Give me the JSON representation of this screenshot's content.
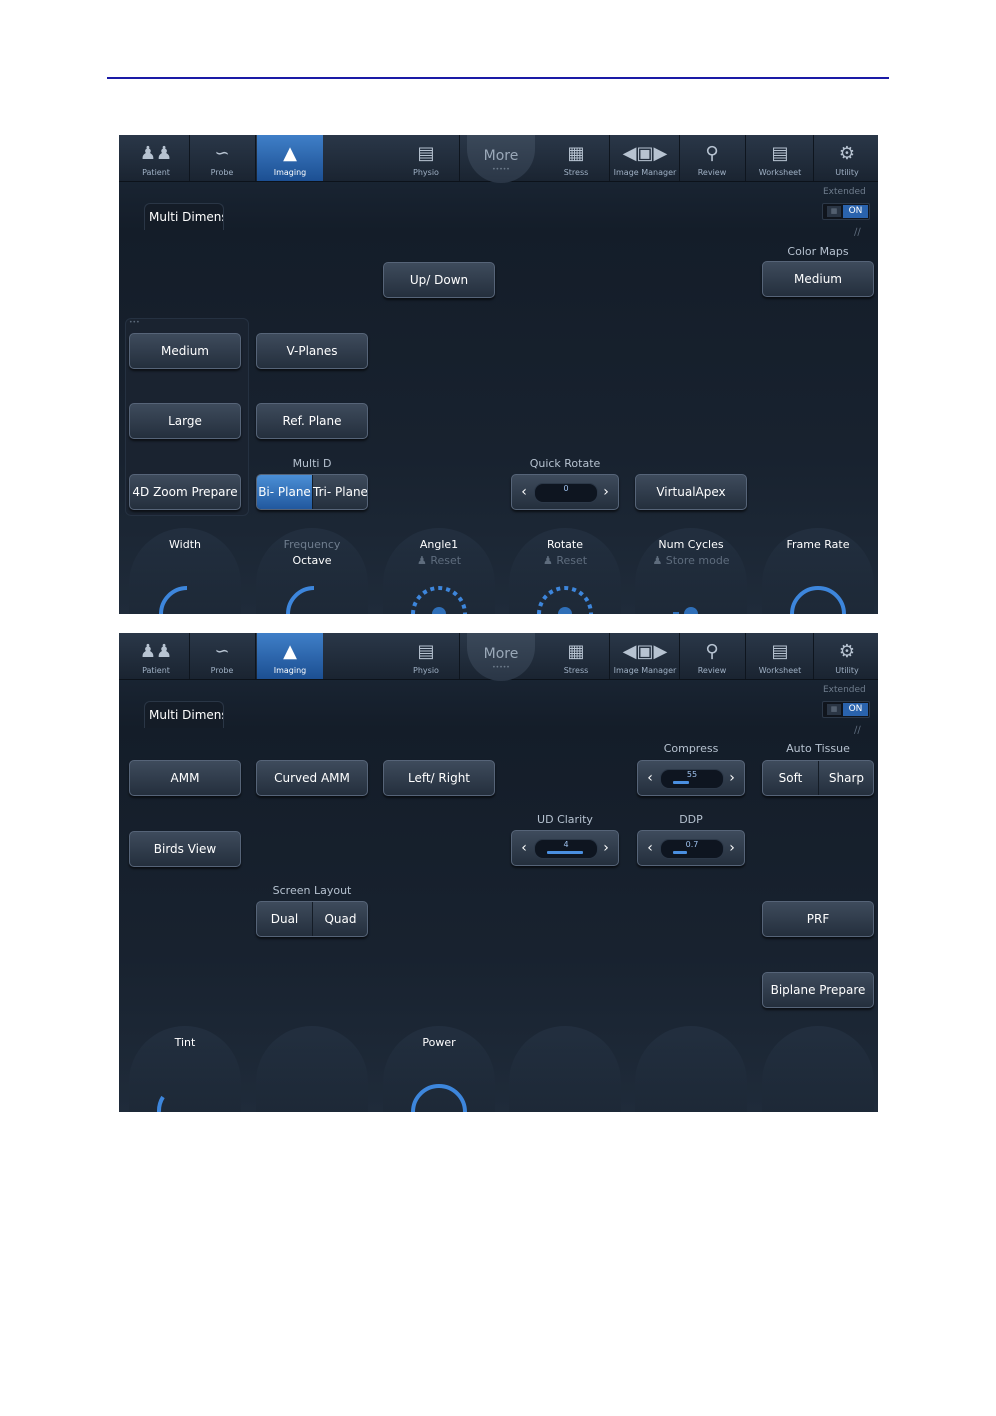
{
  "toolbar": {
    "items": [
      {
        "label": "Patient",
        "icon": "patient-icon"
      },
      {
        "label": "Probe",
        "icon": "probe-icon"
      },
      {
        "label": "Imaging",
        "icon": "imaging-icon"
      },
      {
        "label": "Physio",
        "icon": "physio-icon"
      },
      {
        "label": "Stress",
        "icon": "stress-icon"
      },
      {
        "label": "Image Manager",
        "icon": "image-manager-icon"
      },
      {
        "label": "Review",
        "icon": "review-icon"
      },
      {
        "label": "Worksheet",
        "icon": "worksheet-icon"
      },
      {
        "label": "Utility",
        "icon": "utility-icon"
      }
    ],
    "more_label": "More",
    "active": "Imaging"
  },
  "panel_common": {
    "tab_title": "Multi Dimens",
    "extended_label": "Extended",
    "toggle_on": "ON"
  },
  "panel1": {
    "up_down": "Up/ Down",
    "color_maps_label": "Color Maps",
    "color_maps_value": "Medium",
    "size_medium": "Medium",
    "size_large": "Large",
    "v_planes": "V-Planes",
    "ref_plane": "Ref. Plane",
    "zoom_prepare": "4D Zoom Prepare",
    "multi_d_label": "Multi D",
    "multi_d_options": [
      "Bi- Plane",
      "Tri- Plane"
    ],
    "quick_rotate_label": "Quick Rotate",
    "quick_rotate_value": "0",
    "virtual_apex": "VirtualApex",
    "knobs": {
      "width": "Width",
      "frequency": "Frequency",
      "frequency_sub": "Octave",
      "angle1": "Angle1",
      "angle1_sub": "Reset",
      "rotate": "Rotate",
      "rotate_sub": "Reset",
      "num_cycles": "Num Cycles",
      "num_cycles_sub": "Store mode",
      "frame_rate": "Frame Rate"
    }
  },
  "panel2": {
    "amm": "AMM",
    "curved_amm": "Curved AMM",
    "left_right": "Left/ Right",
    "compress_label": "Compress",
    "compress_value": "55",
    "auto_tissue_label": "Auto Tissue",
    "auto_tissue_options": [
      "Soft",
      "Sharp"
    ],
    "birds_view": "Birds View",
    "ud_clarity_label": "UD Clarity",
    "ud_clarity_value": "4",
    "ddp_label": "DDP",
    "ddp_value": "0.7",
    "screen_layout_label": "Screen Layout",
    "screen_layout_options": [
      "Dual",
      "Quad"
    ],
    "prf": "PRF",
    "biplane_prepare": "Biplane Prepare",
    "knobs": {
      "tint": "Tint",
      "power": "Power"
    }
  },
  "colors": {
    "rule": "#1a1aa6",
    "active_tab": "#3f7fc8",
    "accent": "#2f7fd8"
  }
}
